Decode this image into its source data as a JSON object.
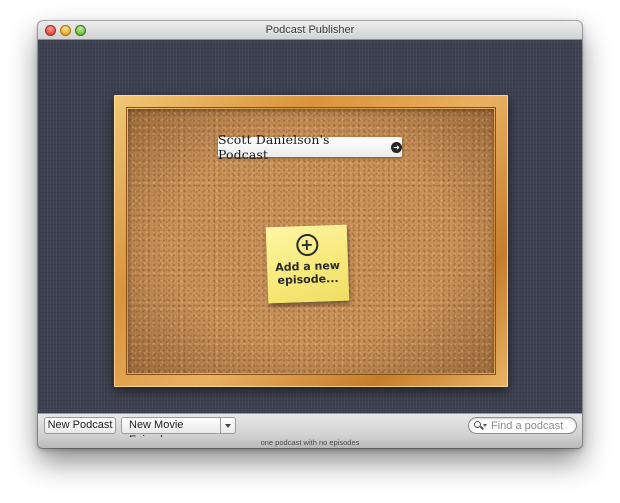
{
  "window": {
    "title": "Podcast Publisher"
  },
  "board": {
    "podcast_name": "Scott Danielson's Podcast",
    "sticky_note_text": "Add a new episode..."
  },
  "toolbar": {
    "new_podcast_label": "New Podcast",
    "new_movie_episode_label": "New Movie Episode"
  },
  "search": {
    "placeholder": "Find a podcast",
    "value": ""
  },
  "status": {
    "text": "one podcast with no episodes"
  },
  "icons": {
    "close": "close-button",
    "minimize": "minimize-button",
    "zoom": "zoom-button",
    "podcast_arrow": "arrow-right-circle-icon",
    "add_episode": "plus-circle-icon",
    "dropdown": "triangle-down-icon",
    "search": "search-icon"
  },
  "colors": {
    "linen_background": "#3e4150",
    "cork": "#c8915a",
    "frame_wood": "#d9943d",
    "sticky_note": "#f7e97a"
  }
}
